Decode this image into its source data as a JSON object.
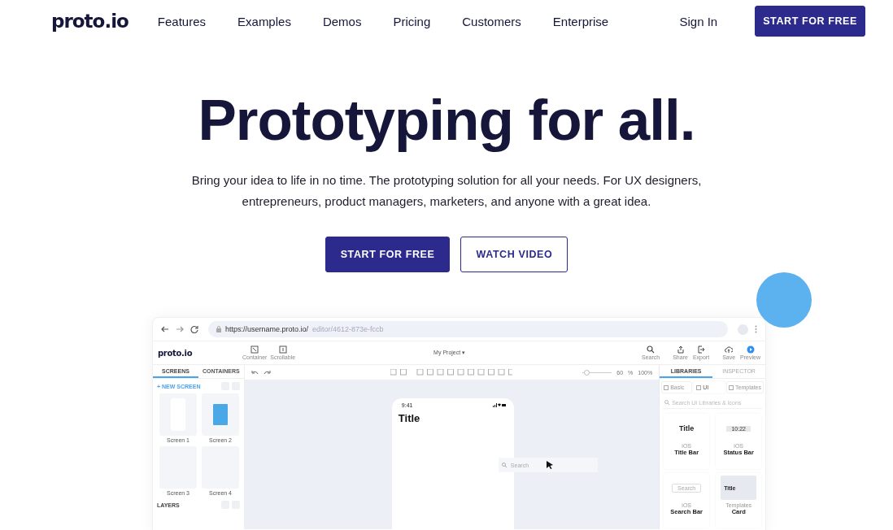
{
  "nav": {
    "logo": "proto.io",
    "links": [
      "Features",
      "Examples",
      "Demos",
      "Pricing",
      "Customers",
      "Enterprise"
    ],
    "sign_in": "Sign In",
    "cta": "START FOR FREE"
  },
  "hero": {
    "title": "Prototyping for all.",
    "subtitle": "Bring your idea to life in no time. The prototyping solution for all your needs. For UX designers, entrepreneurs, product managers, marketers, and anyone with a great idea.",
    "buttons": [
      {
        "label": "START FOR FREE",
        "kind": "primary"
      },
      {
        "label": "WATCH VIDEO",
        "kind": "outline"
      }
    ]
  },
  "mockup": {
    "url": {
      "host": "https://username.proto.io/",
      "path": "editor/4612-873e-fccb"
    },
    "app_logo": "proto.io",
    "tools": [
      {
        "label": "Container"
      },
      {
        "label": "Scrollable"
      }
    ],
    "project": "My Project ▾",
    "actions": [
      {
        "label": "Search"
      },
      {
        "label": "Share"
      },
      {
        "label": "Export"
      },
      {
        "label": "Save"
      },
      {
        "label": "Preview"
      }
    ],
    "left_tabs": [
      {
        "label": "SCREENS",
        "selected": true
      },
      {
        "label": "CONTAINERS",
        "selected": false
      }
    ],
    "new_screen": "+ NEW SCREEN",
    "screens": [
      {
        "label": "Screen 1",
        "kind": "blank"
      },
      {
        "label": "Screen 2",
        "kind": "app"
      },
      {
        "label": "Screen 3",
        "kind": "empty"
      },
      {
        "label": "Screen 4",
        "kind": "empty"
      }
    ],
    "layers": "LAYERS",
    "zoom": {
      "level": 0.12,
      "value": "60",
      "unit": "%",
      "percent": "100%"
    },
    "phone": {
      "time": "9:41",
      "title": "Title"
    },
    "canvas_search": {
      "placeholder": "Search"
    },
    "right_tabs": [
      {
        "label": "LIBRARIES",
        "selected": true
      },
      {
        "label": "INSPECTOR",
        "selected": false
      }
    ],
    "lib_tabs": [
      {
        "label": "Basic",
        "selected": false
      },
      {
        "label": "UI",
        "selected": true
      },
      {
        "label": "Templates",
        "selected": false
      }
    ],
    "lib_search": {
      "placeholder": "Search UI Libraries & Icons"
    },
    "cards": [
      {
        "kind": "title",
        "preview": "Title",
        "caption": "iOS",
        "name": "Title Bar"
      },
      {
        "kind": "status",
        "preview": "10:22",
        "caption": "iOS",
        "name": "Status Bar"
      },
      {
        "kind": "search",
        "preview": "Search",
        "caption": "iOS",
        "name": "Search Bar"
      },
      {
        "kind": "card",
        "preview": "Title",
        "caption": "Templates",
        "name": "Card"
      }
    ]
  }
}
